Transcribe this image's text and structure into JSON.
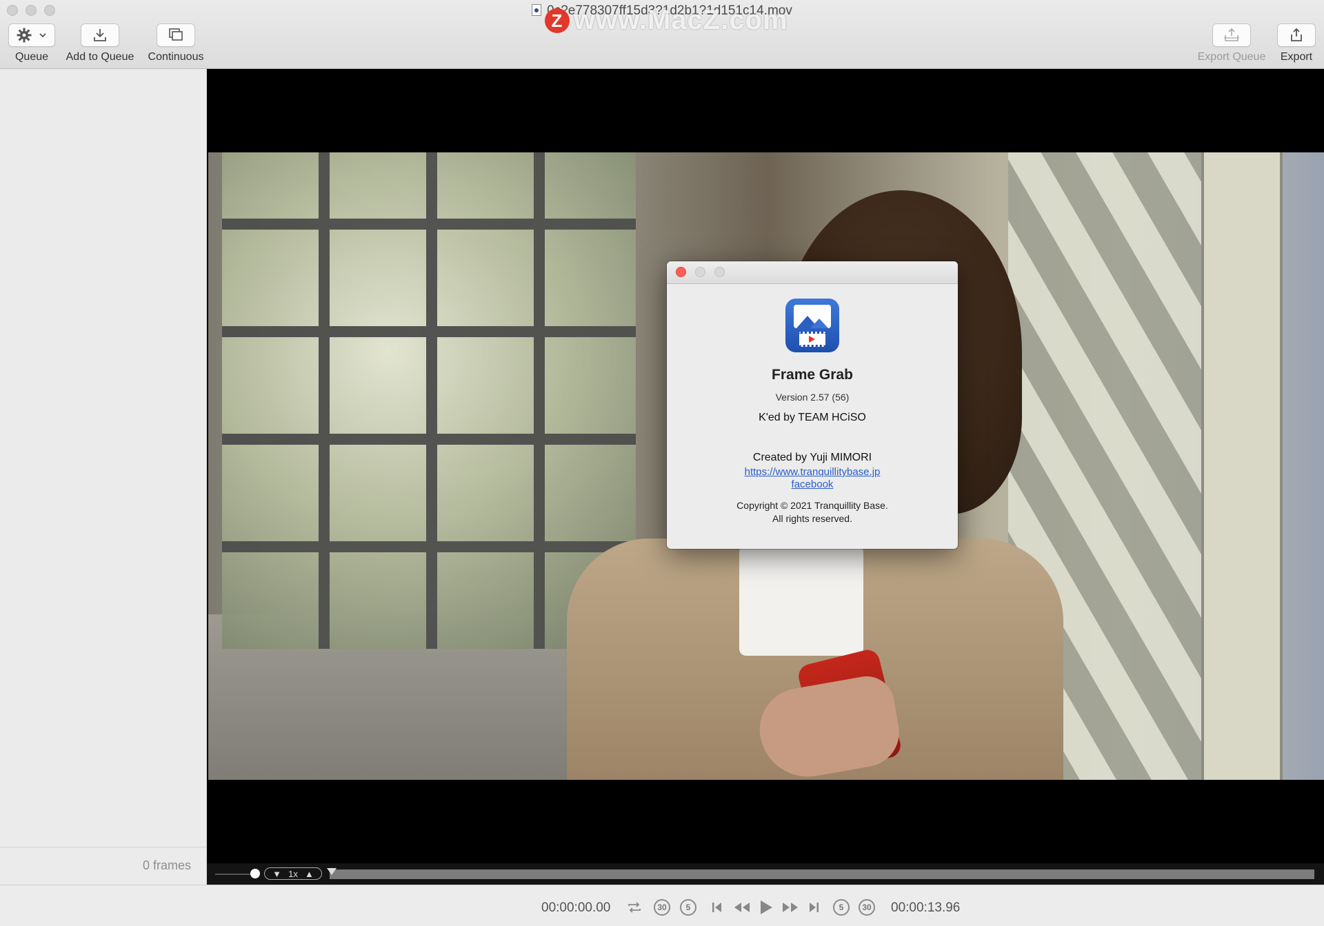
{
  "window": {
    "title": "0c?e778307ff15d3?1d2b1?1d151c14.mov",
    "watermark": "www.MacZ.com",
    "watermark_logo": "Z"
  },
  "toolbar": {
    "queue_label": "Queue",
    "add_to_queue_label": "Add to Queue",
    "continuous_label": "Continuous",
    "export_queue_label": "Export Queue",
    "export_label": "Export",
    "queue_icon": "gear-icon",
    "add_to_queue_icon": "download-tray-icon",
    "continuous_icon": "stacked-frames-icon",
    "export_queue_icon": "export-stack-icon",
    "export_icon": "share-icon"
  },
  "sidebar": {
    "frames_count": "0 frames"
  },
  "scrubber": {
    "speed": "1x",
    "speed_down": "▼",
    "speed_up": "▲"
  },
  "transport": {
    "current_time": "00:00:00.00",
    "duration": "00:00:13.96",
    "skip_back_30": "30",
    "skip_back_5": "5",
    "skip_fwd_5": "5",
    "skip_fwd_30": "30"
  },
  "about": {
    "app_name": "Frame Grab",
    "version": "Version 2.57 (56)",
    "cracked_by": "K'ed by TEAM HCiSO",
    "created_by": "Created by Yuji MIMORI",
    "website": "https://www.tranquillitybase.jp",
    "facebook": "facebook",
    "copyright_line1": "Copyright © 2021 Tranquillity Base.",
    "copyright_line2": "All rights reserved."
  },
  "colors": {
    "close_button": "#fb5f57",
    "link": "#2a5cc8",
    "app_icon": "#2c5fc2"
  }
}
